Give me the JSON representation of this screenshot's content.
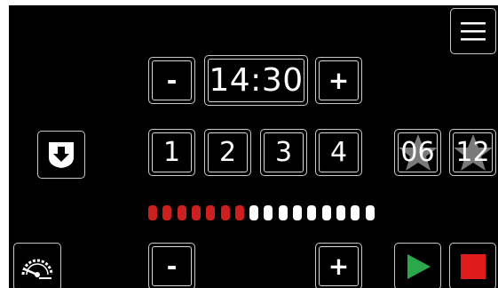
{
  "timer": {
    "time": "14:30",
    "minus_label": "-",
    "plus_label": "+"
  },
  "programs": [
    "1",
    "2",
    "3",
    "4"
  ],
  "favorites": [
    {
      "label": "06",
      "icon": "star-icon"
    },
    {
      "label": "12",
      "icon": "star-icon"
    }
  ],
  "level": {
    "total_segments": 16,
    "active_segments": 7,
    "active_color": "#cc1f1f",
    "inactive_color": "#ffffff",
    "minus_label": "-",
    "plus_label": "+"
  },
  "icons": {
    "menu": "hamburger-menu-icon",
    "save": "download-shield-icon",
    "speed": "speedometer-icon",
    "play": "play-icon",
    "stop": "stop-icon"
  },
  "colors": {
    "background": "#000000",
    "border": "#c8c8c8",
    "play": "#2aa84a",
    "stop": "#e01b1b"
  }
}
